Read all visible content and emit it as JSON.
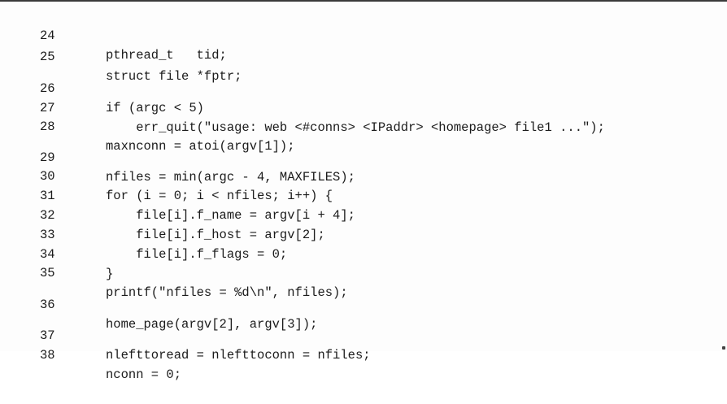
{
  "listing": {
    "lines": [
      {
        "num": "24",
        "code": "pthread_t   tid;"
      },
      {
        "num": "25",
        "code": "struct file *fptr;"
      },
      {
        "num": "26",
        "code": "if (argc < 5)"
      },
      {
        "num": "27",
        "code": "    err_quit(\"usage: web <#conns> <IPaddr> <homepage> file1 ...\");"
      },
      {
        "num": "28",
        "code": "maxnconn = atoi(argv[1]);"
      },
      {
        "num": "29",
        "code": "nfiles = min(argc - 4, MAXFILES);"
      },
      {
        "num": "30",
        "code": "for (i = 0; i < nfiles; i++) {"
      },
      {
        "num": "31",
        "code": "    file[i].f_name = argv[i + 4];"
      },
      {
        "num": "32",
        "code": "    file[i].f_host = argv[2];"
      },
      {
        "num": "33",
        "code": "    file[i].f_flags = 0;"
      },
      {
        "num": "34",
        "code": "}"
      },
      {
        "num": "35",
        "code": "printf(\"nfiles = %d\\n\", nfiles);"
      },
      {
        "num": "36",
        "code": "home_page(argv[2], argv[3]);"
      },
      {
        "num": "37",
        "code": "nlefttoread = nlefttoconn = nfiles;"
      },
      {
        "num": "38",
        "code": "nconn = 0;"
      }
    ]
  }
}
